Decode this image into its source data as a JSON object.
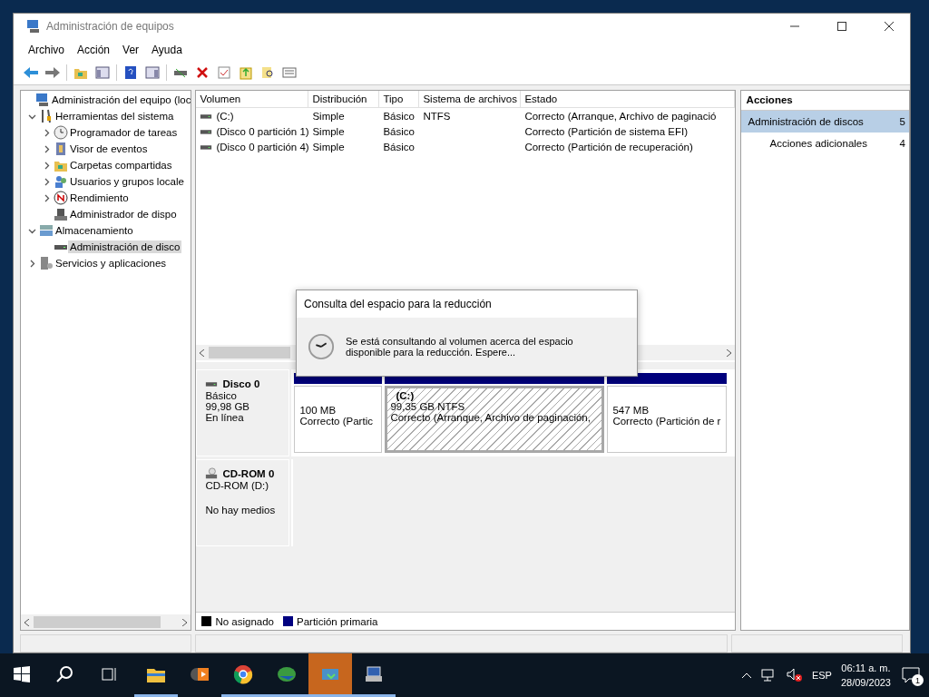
{
  "window": {
    "title": "Administración de equipos"
  },
  "menu": [
    "Archivo",
    "Acción",
    "Ver",
    "Ayuda"
  ],
  "tree": {
    "label": "Administración del equipo (loc",
    "selected": false,
    "children": [
      {
        "label": "Herramientas del sistema",
        "selected": false,
        "expanded": true,
        "children": [
          {
            "label": "Programador de tareas",
            "selected": false,
            "expanded": false
          },
          {
            "label": "Visor de eventos",
            "selected": false,
            "expanded": false
          },
          {
            "label": "Carpetas compartidas",
            "selected": false,
            "expanded": false
          },
          {
            "label": "Usuarios y grupos locale",
            "selected": false,
            "expanded": false
          },
          {
            "label": "Rendimiento",
            "selected": false,
            "expanded": false
          },
          {
            "label": "Administrador de dispo",
            "selected": false
          }
        ]
      },
      {
        "label": "Almacenamiento",
        "selected": false,
        "expanded": true,
        "children": [
          {
            "label": "Administración de disco",
            "selected": true
          }
        ]
      },
      {
        "label": "Servicios y aplicaciones",
        "selected": false,
        "expanded": false
      }
    ]
  },
  "volumes": {
    "columns": [
      "Volumen",
      "Distribución",
      "Tipo",
      "Sistema de archivos",
      "Estado"
    ],
    "rows": [
      [
        "(C:)",
        "Simple",
        "Básico",
        "NTFS",
        "Correcto (Arranque, Archivo de paginació"
      ],
      [
        "(Disco 0 partición 1)",
        "Simple",
        "Básico",
        "",
        "Correcto (Partición de sistema EFI)"
      ],
      [
        "(Disco 0 partición 4)",
        "Simple",
        "Básico",
        "",
        "Correcto (Partición de recuperación)"
      ]
    ]
  },
  "disks": [
    {
      "kind": "disk",
      "name": "Disco 0",
      "lines": [
        "Básico",
        "99,98 GB",
        "En línea"
      ],
      "partitions": [
        {
          "size": "100 MB",
          "status": "Correcto (Partic",
          "selected": false
        },
        {
          "name": "(C:)",
          "size": "99,35 GB NTFS",
          "status": "Correcto (Arranque, Archivo de paginación, ",
          "selected": true
        },
        {
          "size": "547 MB",
          "status": "Correcto (Partición de r",
          "selected": false
        }
      ]
    },
    {
      "kind": "cdrom",
      "name": "CD-ROM 0",
      "lines": [
        "CD-ROM (D:)",
        "No hay medios"
      ]
    }
  ],
  "legend": [
    {
      "label": "No asignado",
      "color": "#000000"
    },
    {
      "label": "Partición primaria",
      "color": "#000080"
    }
  ],
  "actions": {
    "title": "Acciones",
    "items": [
      {
        "label": "Administración de discos",
        "glyph": "5",
        "selected": true
      },
      {
        "label": "Acciones adicionales",
        "glyph": "4",
        "selected": false
      }
    ]
  },
  "dialog": {
    "title": "Consulta del espacio para la reducción",
    "message": "Se está consultando al volumen acerca del espacio disponible para la reducción. Espere..."
  },
  "taskbar": {
    "apps": [
      {
        "running": true,
        "flashing": false
      },
      {
        "running": false,
        "flashing": false
      },
      {
        "running": true,
        "flashing": false
      },
      {
        "running": true,
        "flashing": false
      },
      {
        "running": true,
        "flashing": true
      },
      {
        "running": true,
        "flashing": false
      }
    ],
    "language": "ESP",
    "time": "06:11 a. m.",
    "date": "28/09/2023",
    "notifications": "1"
  }
}
